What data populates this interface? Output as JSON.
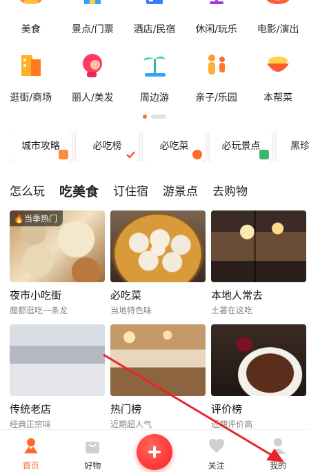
{
  "categories_row1": [
    {
      "label": "美食",
      "icon": "food-icon"
    },
    {
      "label": "景点/门票",
      "icon": "attraction-icon"
    },
    {
      "label": "酒店/民宿",
      "icon": "hotel-icon"
    },
    {
      "label": "休闲/玩乐",
      "icon": "leisure-icon"
    },
    {
      "label": "电影/演出",
      "icon": "movie-icon"
    }
  ],
  "categories_row2": [
    {
      "label": "逛街/商场",
      "icon": "shopping-icon"
    },
    {
      "label": "丽人/美发",
      "icon": "beauty-icon"
    },
    {
      "label": "周边游",
      "icon": "nearby-travel-icon"
    },
    {
      "label": "亲子/乐园",
      "icon": "family-icon"
    },
    {
      "label": "本帮菜",
      "icon": "local-cuisine-icon"
    }
  ],
  "tags": [
    {
      "label": "城市攻略",
      "badge_color": "#ff8a3a"
    },
    {
      "label": "必吃榜",
      "badge_color": "#ff4a4a"
    },
    {
      "label": "必吃菜",
      "badge_color": "#ff6a28"
    },
    {
      "label": "必玩景点",
      "badge_color": "#3db56a"
    },
    {
      "label": "黑珍"
    }
  ],
  "tabs": [
    {
      "label": "怎么玩",
      "active": false
    },
    {
      "label": "吃美食",
      "active": true
    },
    {
      "label": "订住宿",
      "active": false
    },
    {
      "label": "游景点",
      "active": false
    },
    {
      "label": "去购物",
      "active": false
    }
  ],
  "cards": [
    {
      "title": "夜市小吃街",
      "subtitle": "魔都逛吃一条龙",
      "badge": "当季热门"
    },
    {
      "title": "必吃菜",
      "subtitle": "当地特色味"
    },
    {
      "title": "本地人常去",
      "subtitle": "土著在这吃"
    },
    {
      "title": "传统老店",
      "subtitle": "经典正宗味"
    },
    {
      "title": "热门榜",
      "subtitle": "近期超人气"
    },
    {
      "title": "评价榜",
      "subtitle": "近期评价高"
    }
  ],
  "bottom_nav": [
    {
      "label": "首页",
      "icon": "home-icon",
      "active": true
    },
    {
      "label": "好物",
      "icon": "shopping-bag-icon",
      "active": false
    },
    {
      "label": "关注",
      "icon": "heart-icon",
      "active": false
    },
    {
      "label": "我的",
      "icon": "profile-icon",
      "active": false
    }
  ],
  "colors": {
    "accent": "#ff6a28",
    "fab": "#ff3a3a",
    "annotation_arrow": "#e8232a"
  }
}
